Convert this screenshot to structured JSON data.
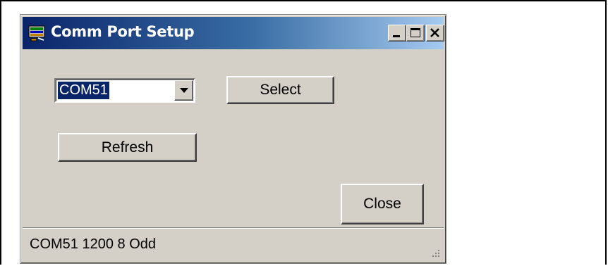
{
  "window": {
    "title": "Comm Port Setup",
    "icon": "comm-port-app-icon"
  },
  "title_buttons": {
    "minimize": "minimize-icon",
    "maximize": "maximize-icon",
    "close": "close-icon"
  },
  "port_select": {
    "selected": "COM51"
  },
  "buttons": {
    "select_label": "Select",
    "refresh_label": "Refresh",
    "close_label": "Close"
  },
  "status": {
    "text": "COM51 1200 8 Odd"
  },
  "colors": {
    "face": "#d4d0c8",
    "title_start": "#0a246a",
    "title_end": "#a6caf0",
    "selection": "#0a246a"
  }
}
